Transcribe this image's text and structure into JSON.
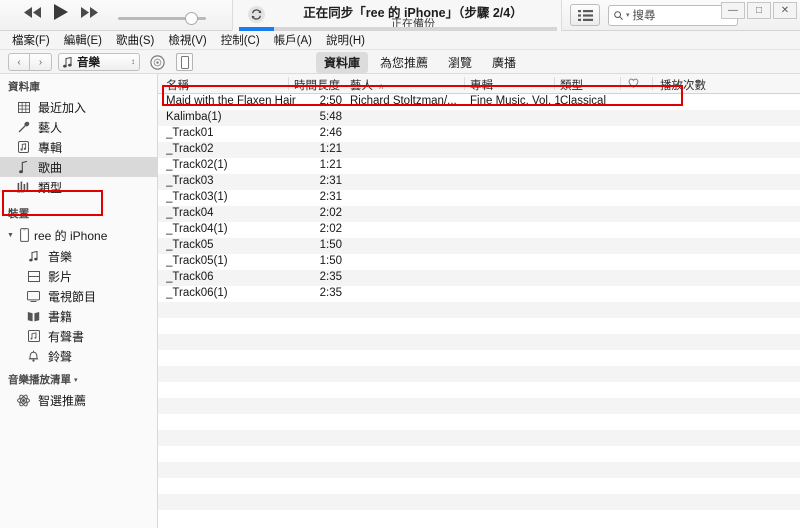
{
  "window": {
    "controls": [
      {
        "name": "minimize",
        "glyph": "—"
      },
      {
        "name": "maximize",
        "glyph": "□"
      },
      {
        "name": "close",
        "glyph": "✕"
      }
    ]
  },
  "transport": {
    "rewind_icon": "rewind-icon",
    "play_icon": "play-icon",
    "forward_icon": "fast-forward-icon",
    "volume_percent": 88
  },
  "status": {
    "sync_icon": "sync-icon",
    "title": "正在同步「ree 的 iPhone」（步驟 2/4）",
    "subtitle": "正在備份",
    "progress_percent": 11,
    "progress_color": "#1a7ef2"
  },
  "toolbar_right": {
    "list_view_icon": "list-view-icon",
    "search": {
      "icon": "search-icon",
      "chevron": "chevron-down-icon",
      "placeholder": "搜尋",
      "value": ""
    }
  },
  "menubar": {
    "items": [
      {
        "label": "檔案(F)"
      },
      {
        "label": "編輯(E)"
      },
      {
        "label": "歌曲(S)"
      },
      {
        "label": "檢視(V)"
      },
      {
        "label": "控制(C)"
      },
      {
        "label": "帳戶(A)"
      },
      {
        "label": "說明(H)"
      }
    ]
  },
  "navrow": {
    "back_label": "‹",
    "forward_label": "›",
    "media_picker": {
      "label": "音樂",
      "icon": "music-note-icon",
      "chevron": "updown-chevron-icon"
    },
    "disc_icon": "disc-icon",
    "device_icon": "device-icon",
    "tabs": [
      {
        "label": "資料庫",
        "active": true
      },
      {
        "label": "為您推薦",
        "active": false
      },
      {
        "label": "瀏覽",
        "active": false
      },
      {
        "label": "廣播",
        "active": false
      }
    ]
  },
  "sidebar": {
    "library_header": "資料庫",
    "library_items": [
      {
        "label": "最近加入",
        "icon": "grid-icon",
        "selected": false
      },
      {
        "label": "藝人",
        "icon": "microphone-icon",
        "selected": false
      },
      {
        "label": "專輯",
        "icon": "album-icon",
        "selected": false
      },
      {
        "label": "歌曲",
        "icon": "music-note-icon",
        "selected": true
      },
      {
        "label": "類型",
        "icon": "genre-icon",
        "selected": false
      }
    ],
    "devices_header": "裝置",
    "device": {
      "label": "ree 的 iPhone",
      "icon": "iphone-icon",
      "expanded": true
    },
    "device_items": [
      {
        "label": "音樂",
        "icon": "music-note-icon"
      },
      {
        "label": "影片",
        "icon": "film-icon"
      },
      {
        "label": "電視節目",
        "icon": "tv-icon"
      },
      {
        "label": "書籍",
        "icon": "book-icon"
      },
      {
        "label": "有聲書",
        "icon": "audiobook-icon"
      },
      {
        "label": "鈴聲",
        "icon": "bell-icon"
      }
    ],
    "playlists_header": "音樂播放清單",
    "playlists_chevron": "chevron-down-icon",
    "playlists": [
      {
        "label": "智選推薦",
        "icon": "genius-atom-icon"
      }
    ]
  },
  "tracklist": {
    "columns": {
      "name": "名稱",
      "time": "時間長度",
      "artist": "藝人",
      "artist_sort": "∧",
      "album": "專輯",
      "genre": "類型",
      "love": "heart-icon",
      "plays": "播放次數"
    },
    "rows": [
      {
        "name": "Maid with the Flaxen Hair",
        "time": "2:50",
        "artist": "Richard Stoltzman/...",
        "album": "Fine Music, Vol. 1",
        "genre": "Classical"
      },
      {
        "name": "Kalimba(1)",
        "time": "5:48",
        "artist": "",
        "album": "",
        "genre": ""
      },
      {
        "name": "_Track01",
        "time": "2:46",
        "artist": "",
        "album": "",
        "genre": ""
      },
      {
        "name": "_Track02",
        "time": "1:21",
        "artist": "",
        "album": "",
        "genre": ""
      },
      {
        "name": "_Track02(1)",
        "time": "1:21",
        "artist": "",
        "album": "",
        "genre": ""
      },
      {
        "name": "_Track03",
        "time": "2:31",
        "artist": "",
        "album": "",
        "genre": ""
      },
      {
        "name": "_Track03(1)",
        "time": "2:31",
        "artist": "",
        "album": "",
        "genre": ""
      },
      {
        "name": "_Track04",
        "time": "2:02",
        "artist": "",
        "album": "",
        "genre": ""
      },
      {
        "name": "_Track04(1)",
        "time": "2:02",
        "artist": "",
        "album": "",
        "genre": ""
      },
      {
        "name": "_Track05",
        "time": "1:50",
        "artist": "",
        "album": "",
        "genre": ""
      },
      {
        "name": "_Track05(1)",
        "time": "1:50",
        "artist": "",
        "album": "",
        "genre": ""
      },
      {
        "name": "_Track06",
        "time": "2:35",
        "artist": "",
        "album": "",
        "genre": ""
      },
      {
        "name": "_Track06(1)",
        "time": "2:35",
        "artist": "",
        "album": "",
        "genre": ""
      }
    ]
  },
  "annotations": {
    "color": "#e00000",
    "boxes": [
      {
        "name": "highlight-first-track"
      },
      {
        "name": "highlight-device"
      }
    ]
  }
}
